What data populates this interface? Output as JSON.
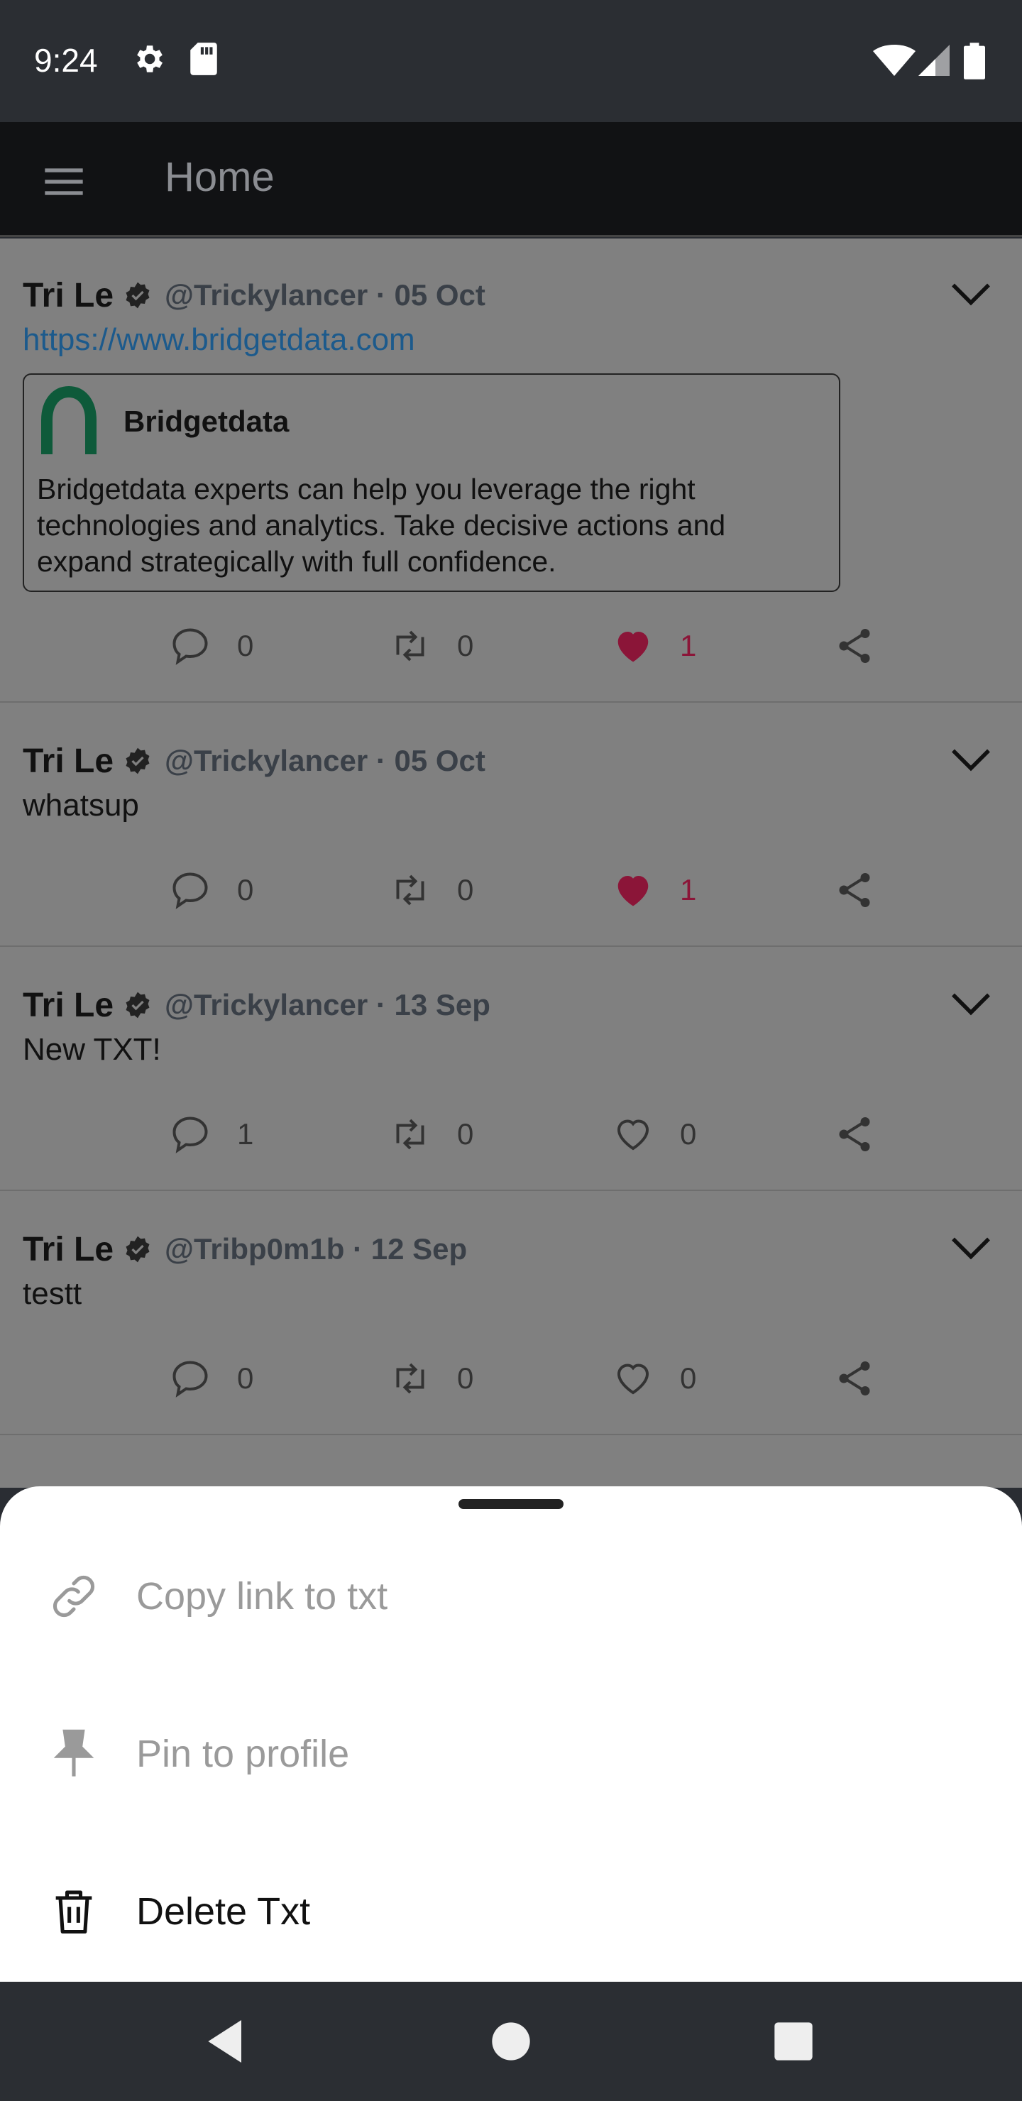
{
  "status_bar": {
    "time": "9:24",
    "icons": [
      "gear-icon",
      "sd-card-icon",
      "wifi-icon",
      "signal-icon",
      "battery-icon"
    ]
  },
  "app_bar": {
    "title": "Home",
    "menu_icon": "hamburger-menu-icon"
  },
  "posts": [
    {
      "name": "Tri Le",
      "handle": "@Trickylancer · 05 Oct",
      "link": "https://www.bridgetdata.com",
      "card": {
        "title": "Bridgetdata",
        "description": "Bridgetdata experts can help you leverage the right technologies and analytics. Take decisive actions and expand strategically with full confidence."
      },
      "comments": "0",
      "retweets": "0",
      "likes": "1",
      "liked": true
    },
    {
      "name": "Tri Le",
      "handle": "@Trickylancer · 05 Oct",
      "text": "whatsup",
      "comments": "0",
      "retweets": "0",
      "likes": "1",
      "liked": true
    },
    {
      "name": "Tri Le",
      "handle": "@Trickylancer · 13 Sep",
      "text": "New TXT!",
      "comments": "1",
      "retweets": "0",
      "likes": "0",
      "liked": false
    },
    {
      "name": "Tri Le",
      "handle": "@Tribp0m1b · 12 Sep",
      "text": "testt",
      "comments": "0",
      "retweets": "0",
      "likes": "0",
      "liked": false
    }
  ],
  "bottom_sheet": {
    "items": [
      {
        "label": "Copy link to txt",
        "icon": "link-icon",
        "enabled": false
      },
      {
        "label": "Pin to profile",
        "icon": "pin-icon",
        "enabled": false
      },
      {
        "label": "Delete Txt",
        "icon": "trash-icon",
        "enabled": true
      }
    ]
  },
  "colors": {
    "accent_like": "#8b1538",
    "link": "#1c5a8c",
    "status_bar": "#2b2e33",
    "app_bar": "#111214"
  }
}
